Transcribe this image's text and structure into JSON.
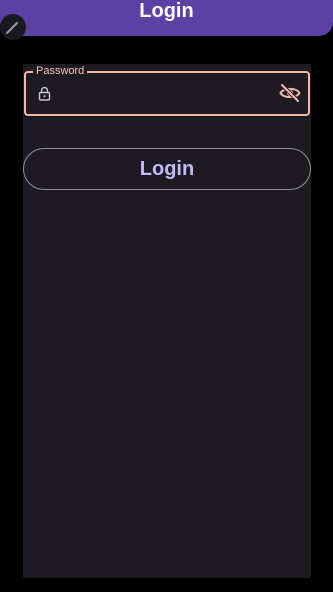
{
  "app_bar": {
    "title": "Login"
  },
  "form": {
    "password": {
      "label": "Password",
      "value": "",
      "leading_icon": "lock-icon",
      "trailing_icon": "eye-off-icon",
      "border_color": "#f0b9aa"
    },
    "login_button": {
      "label": "Login"
    }
  },
  "colors": {
    "app_bar": "#5c40a4",
    "panel": "#1d1b21",
    "background": "#000000",
    "button_text": "#c4b8f8"
  }
}
